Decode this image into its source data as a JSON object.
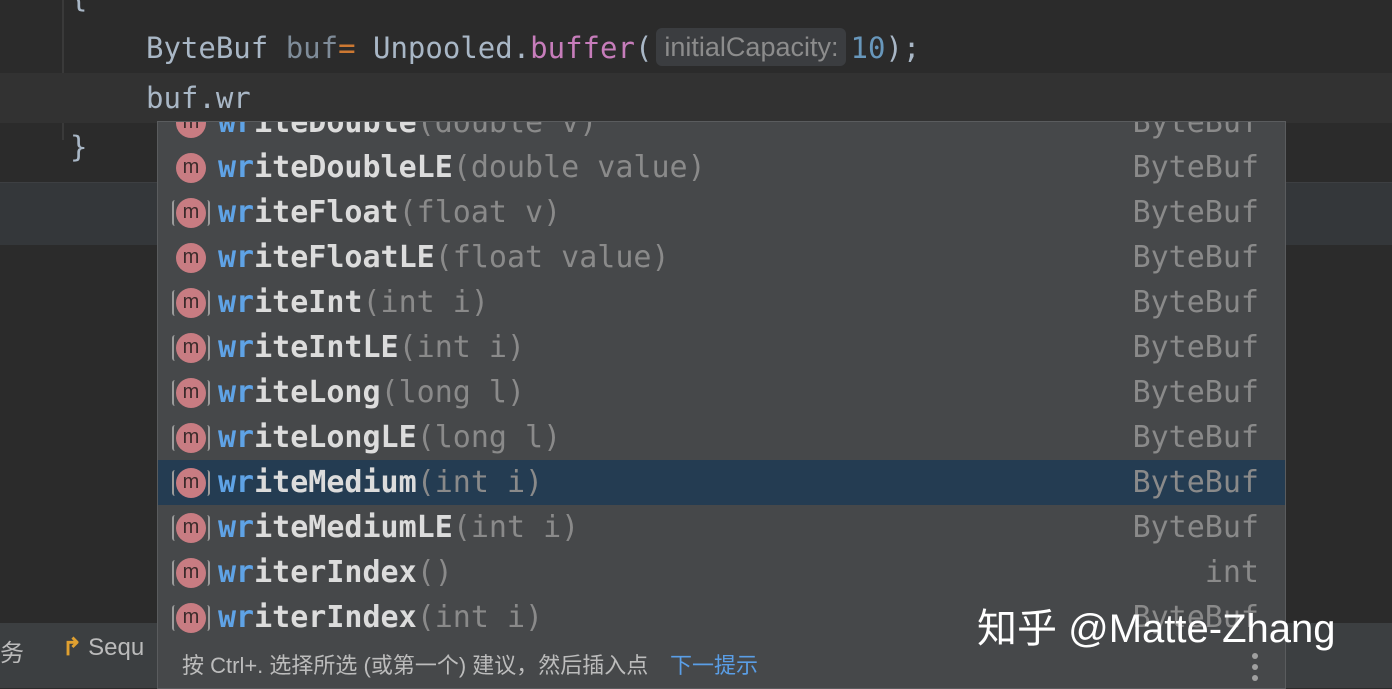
{
  "code": {
    "line0_brace": "{",
    "line1": {
      "type": "ByteBuf",
      "var": "buf",
      "op": "=",
      "class": "Unpooled",
      "dot": ".",
      "method": "buffer",
      "paren_open": "(",
      "param_hint": "initialCapacity:",
      "arg": "10",
      "end": ");"
    },
    "line2": "buf.wr",
    "line3_brace": "}"
  },
  "completion": {
    "items": [
      {
        "prefix": "wr",
        "rest": "iteDouble",
        "params": "(double v)",
        "type": "ByteBuf",
        "static": false
      },
      {
        "prefix": "wr",
        "rest": "iteDoubleLE",
        "params": "(double value)",
        "type": "ByteBuf",
        "static": false
      },
      {
        "prefix": "wr",
        "rest": "iteFloat",
        "params": "(float v)",
        "type": "ByteBuf",
        "static": true
      },
      {
        "prefix": "wr",
        "rest": "iteFloatLE",
        "params": "(float value)",
        "type": "ByteBuf",
        "static": false
      },
      {
        "prefix": "wr",
        "rest": "iteInt",
        "params": "(int i)",
        "type": "ByteBuf",
        "static": true
      },
      {
        "prefix": "wr",
        "rest": "iteIntLE",
        "params": "(int i)",
        "type": "ByteBuf",
        "static": true
      },
      {
        "prefix": "wr",
        "rest": "iteLong",
        "params": "(long l)",
        "type": "ByteBuf",
        "static": true
      },
      {
        "prefix": "wr",
        "rest": "iteLongLE",
        "params": "(long l)",
        "type": "ByteBuf",
        "static": true
      },
      {
        "prefix": "wr",
        "rest": "iteMedium",
        "params": "(int i)",
        "type": "ByteBuf",
        "static": true,
        "selected": true
      },
      {
        "prefix": "wr",
        "rest": "iteMediumLE",
        "params": "(int i)",
        "type": "ByteBuf",
        "static": true
      },
      {
        "prefix": "wr",
        "rest": "iterIndex",
        "params": "()",
        "type": "int",
        "static": true
      },
      {
        "prefix": "wr",
        "rest": "iterIndex",
        "params": "(int i)",
        "type": "ByteBuf",
        "static": true
      }
    ],
    "icon_letter": "m",
    "footer_text": "按 Ctrl+. 选择所选 (或第一个) 建议，然后插入点",
    "footer_link": "下一提示"
  },
  "bottom_bar": {
    "left_text": "务",
    "seq_label": "Sequ"
  },
  "watermark": "知乎 @Matte-Zhang"
}
